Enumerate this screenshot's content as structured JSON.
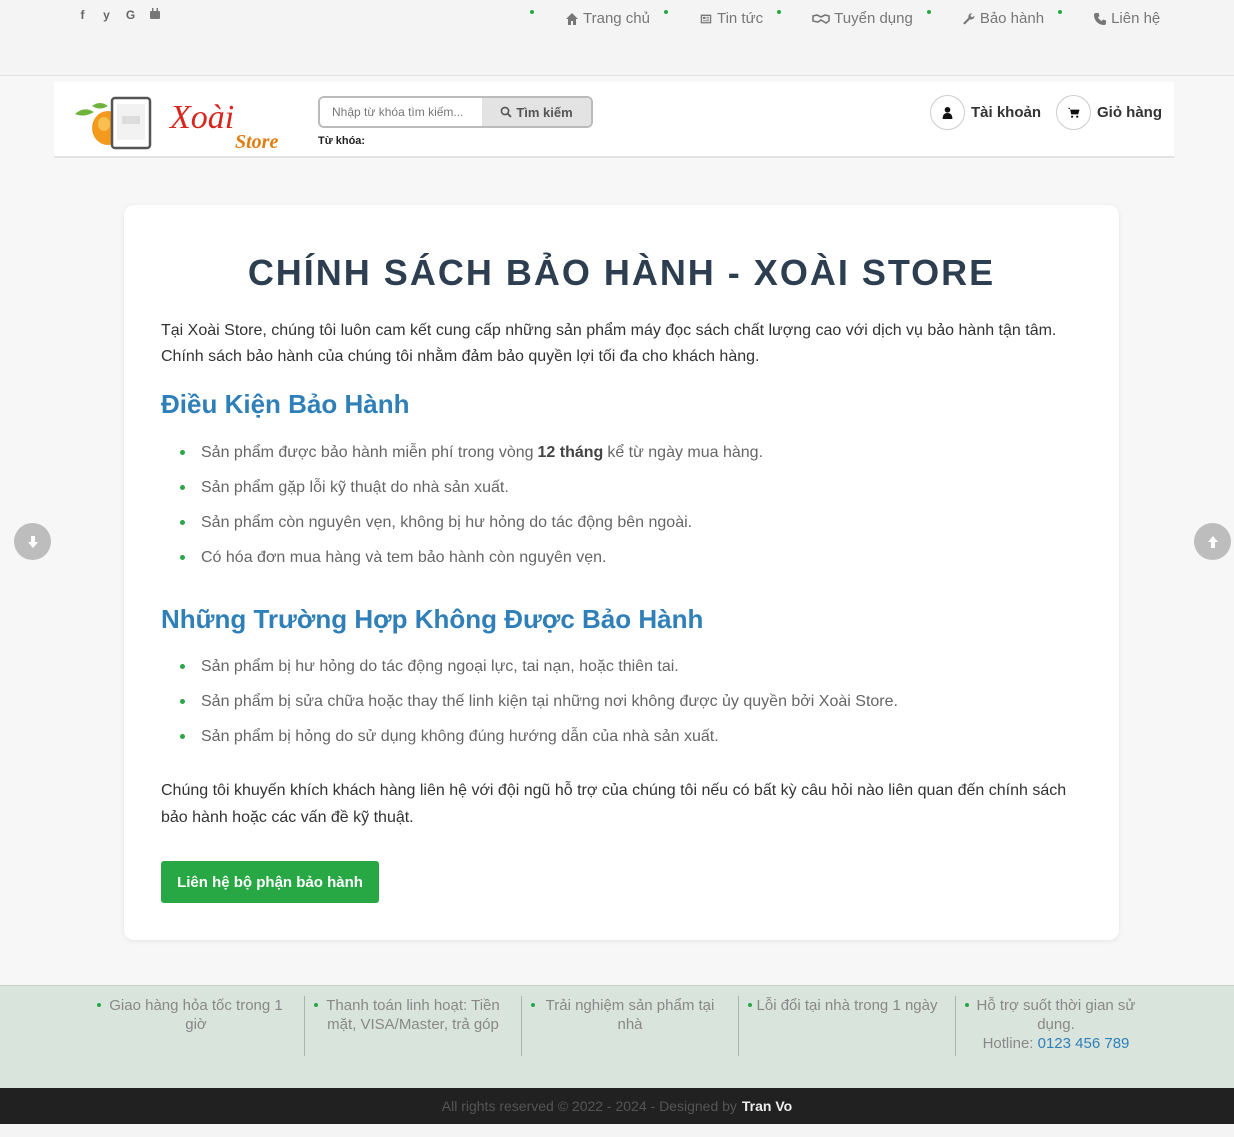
{
  "social": [
    "f",
    "y",
    "G",
    "yt"
  ],
  "nav": [
    {
      "label": "Trang chủ",
      "icon": "home-icon"
    },
    {
      "label": "Tin tức",
      "icon": "newspaper-icon"
    },
    {
      "label": "Tuyển dụng",
      "icon": "handshake-icon"
    },
    {
      "label": "Bảo hành",
      "icon": "wrench-icon"
    },
    {
      "label": "Liên hệ",
      "icon": "phone-icon"
    }
  ],
  "search": {
    "placeholder": "Nhập từ khóa tìm kiếm...",
    "button_label": "Tìm kiếm",
    "keywords_label": "Từ khóa:"
  },
  "header": {
    "logo_text": "Xoài",
    "logo_sub": "Store",
    "account_label": "Tài khoản",
    "cart_label": "Giỏ hàng"
  },
  "page": {
    "title": "CHÍNH SÁCH BẢO HÀNH - XOÀI STORE",
    "intro": "Tại Xoài Store, chúng tôi luôn cam kết cung cấp những sản phẩm máy đọc sách chất lượng cao với dịch vụ bảo hành tận tâm. Chính sách bảo hành của chúng tôi nhằm đảm bảo quyền lợi tối đa cho khách hàng.",
    "section1": {
      "heading": "Điều Kiện Bảo Hành",
      "item1_before": "Sản phẩm được bảo hành miễn phí trong vòng",
      "item1_bold": "12 tháng",
      "item1_after": "kể từ ngày mua hàng.",
      "items": [
        "Sản phẩm gặp lỗi kỹ thuật do nhà sản xuất.",
        "Sản phẩm còn nguyên vẹn, không bị hư hỏng do tác động bên ngoài.",
        "Có hóa đơn mua hàng và tem bảo hành còn nguyên vẹn."
      ]
    },
    "section2": {
      "heading": "Những Trường Hợp Không Được Bảo Hành",
      "items": [
        "Sản phẩm bị hư hỏng do tác động ngoại lực, tai nạn, hoặc thiên tai.",
        "Sản phẩm bị sửa chữa hoặc thay thế linh kiện tại những nơi không được ủy quyền bởi Xoài Store.",
        "Sản phẩm bị hỏng do sử dụng không đúng hướng dẫn của nhà sản xuất."
      ]
    },
    "outro": "Chúng tôi khuyến khích khách hàng liên hệ với đội ngũ hỗ trợ của chúng tôi nếu có bất kỳ câu hỏi nào liên quan đến chính sách bảo hành hoặc các vấn đề kỹ thuật.",
    "cta_label": "Liên hệ bộ phận bảo hành"
  },
  "features": [
    "Giao hàng hỏa tốc trong 1 giờ",
    "Thanh toán linh hoạt: Tiền mặt, VISA/Master, trả góp",
    "Trải nghiệm sản phẩm tại nhà",
    "Lỗi đổi tại nhà trong 1 ngày",
    "Hỗ trợ suốt thời gian sử dụng."
  ],
  "hotline": {
    "label": "Hotline:",
    "number": "0123 456 789"
  },
  "footer": {
    "copyright": "All rights reserved © 2022 - 2024 - Designed by",
    "designer": "Tran Vo"
  },
  "colors": {
    "accent_green": "#28a745",
    "heading_blue": "#2f7fb9",
    "title_navy": "#2c3e50",
    "logo_red": "#d9251d",
    "logo_orange": "#e07c12"
  }
}
